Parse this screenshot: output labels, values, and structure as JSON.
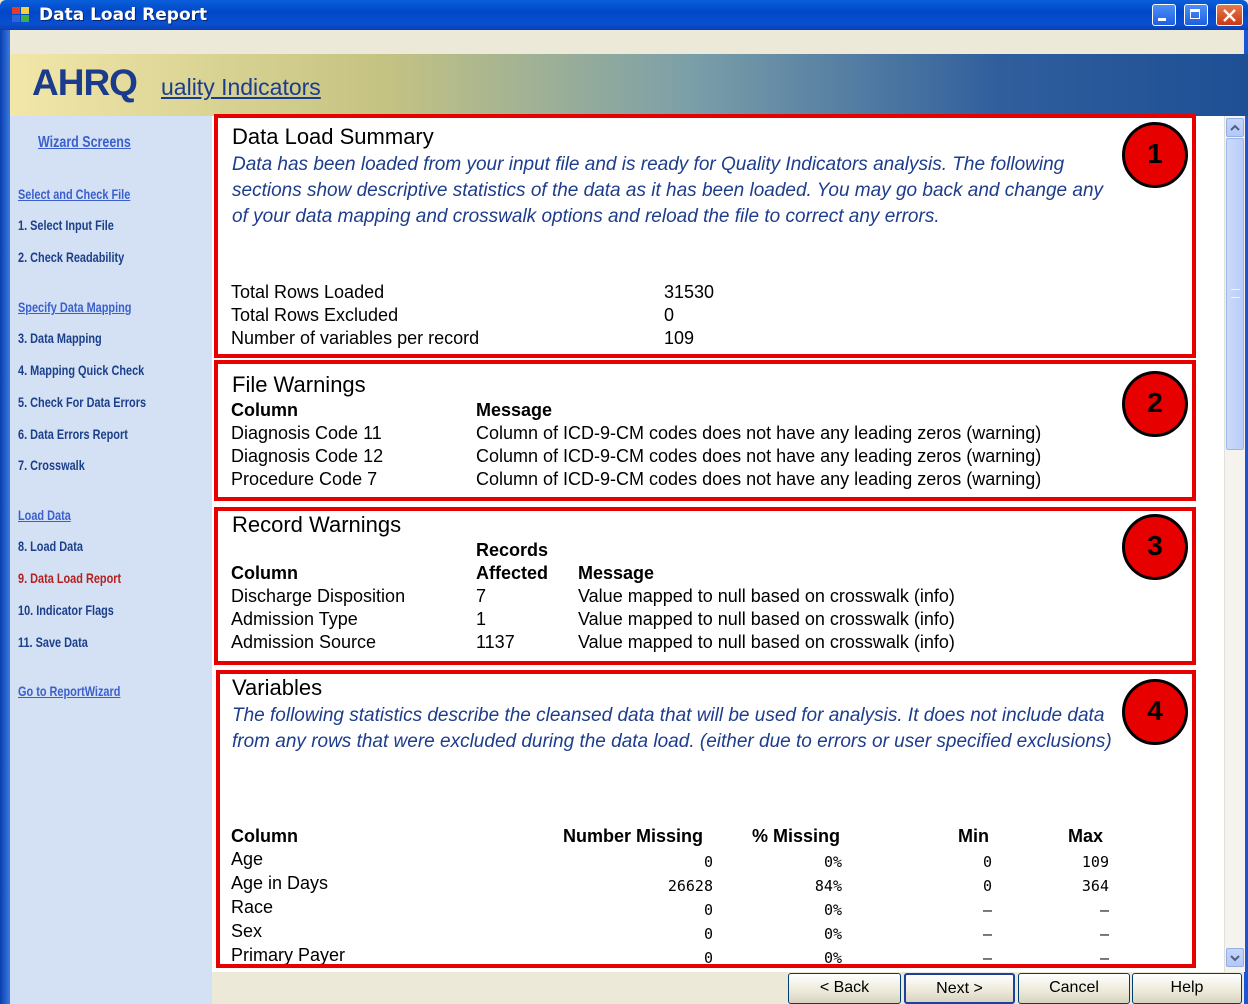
{
  "window": {
    "title": "Data Load Report"
  },
  "banner": {
    "logo_big": "AHRQ",
    "logo_small": "uality Indicators"
  },
  "sidebar": {
    "header": "Wizard Screens",
    "groups": [
      {
        "label": "Select and Check File",
        "items": [
          "1. Select Input File",
          "2. Check Readability"
        ]
      },
      {
        "label": "Specify Data Mapping",
        "items": [
          "3. Data Mapping",
          "4. Mapping Quick Check",
          "5. Check For Data Errors",
          "6. Data Errors Report",
          "7. Crosswalk"
        ]
      },
      {
        "label": "Load Data",
        "items": [
          "8. Load Data",
          "9. Data Load Report",
          "10. Indicator Flags",
          "11. Save Data"
        ]
      }
    ],
    "report_link": "Go to ReportWizard"
  },
  "summary": {
    "badge": "1",
    "title": "Data Load Summary",
    "desc": "Data has been loaded from your input file and is ready for Quality Indicators analysis. The following sections show descriptive statistics of the data as it has been loaded. You may go back and change any of your data mapping and crosswalk options and reload the file to correct any errors.",
    "rows": [
      {
        "label": "Total Rows Loaded",
        "value": "31530"
      },
      {
        "label": "Total Rows Excluded",
        "value": "0"
      },
      {
        "label": "Number of variables per record",
        "value": "109"
      }
    ]
  },
  "file_warnings": {
    "badge": "2",
    "title": "File Warnings",
    "headers": [
      "Column",
      "Message"
    ],
    "rows": [
      {
        "column": "Diagnosis Code 11",
        "message": "Column of ICD-9-CM codes does not have any leading zeros (warning)"
      },
      {
        "column": "Diagnosis Code 12",
        "message": "Column of ICD-9-CM codes does not have any leading zeros (warning)"
      },
      {
        "column": "Procedure Code 7",
        "message": "Column of ICD-9-CM codes does not have any leading zeros (warning)"
      }
    ]
  },
  "record_warnings": {
    "badge": "3",
    "title": "Record Warnings",
    "headers": [
      "Column",
      "Records",
      "Affected",
      "Message"
    ],
    "rows": [
      {
        "column": "Discharge Disposition",
        "affected": "7",
        "message": "Value mapped to null based on crosswalk (info)"
      },
      {
        "column": "Admission Type",
        "affected": "1",
        "message": "Value mapped to null based on crosswalk (info)"
      },
      {
        "column": "Admission Source",
        "affected": "1137",
        "message": "Value mapped to null based on crosswalk (info)"
      }
    ]
  },
  "variables": {
    "badge": "4",
    "title": "Variables",
    "desc": "The following statistics describe the cleansed data that will be used for analysis.  It does not include data from any rows that were excluded during the data load. (either due to errors or user specified exclusions)",
    "headers": [
      "Column",
      "Number Missing",
      "% Missing",
      "Min",
      "Max"
    ],
    "rows": [
      {
        "column": "Age",
        "missing": "0",
        "pct": "0%",
        "min": "0",
        "max": "109"
      },
      {
        "column": "Age in Days",
        "missing": "26628",
        "pct": "84%",
        "min": "0",
        "max": "364"
      },
      {
        "column": "Race",
        "missing": "0",
        "pct": "0%",
        "min": "–",
        "max": "–"
      },
      {
        "column": "Sex",
        "missing": "0",
        "pct": "0%",
        "min": "–",
        "max": "–"
      },
      {
        "column": "Primary Payer",
        "missing": "0",
        "pct": "0%",
        "min": "–",
        "max": "–"
      }
    ]
  },
  "buttons": {
    "back": "< Back",
    "next": "Next >",
    "cancel": "Cancel",
    "help": "Help"
  },
  "colors": {
    "highlight_border": "#e60000",
    "description_text": "#1d3c8c",
    "title_bar": "#0a4fcf"
  }
}
